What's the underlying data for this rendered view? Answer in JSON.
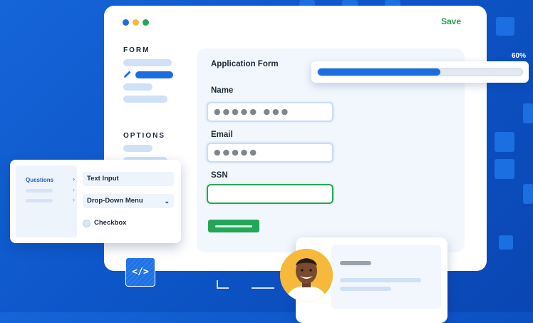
{
  "window": {
    "save_label": "Save",
    "dot_colors": [
      "#1b6ee0",
      "#f6b93b",
      "#23a65a"
    ]
  },
  "sidebar": {
    "form_heading": "FORM",
    "options_heading": "OPTIONS"
  },
  "form": {
    "title": "Application Form",
    "fields": [
      {
        "label": "Name",
        "value": "●●●●●  ●●●"
      },
      {
        "label": "Email",
        "value": "●●●●●"
      },
      {
        "label": "SSN",
        "value": ""
      }
    ]
  },
  "progress": {
    "percent_label": "60%",
    "value": 0.6
  },
  "builder": {
    "questions_label": "Questions",
    "items": [
      {
        "label": "Text Input"
      },
      {
        "label": "Drop-Down Menu"
      },
      {
        "label": "Checkbox"
      }
    ]
  },
  "code_tile": {
    "glyph": "</>"
  },
  "colors": {
    "accent_blue": "#1b6ee0",
    "success_green": "#23a65a",
    "background_blue": "#1565d8"
  }
}
